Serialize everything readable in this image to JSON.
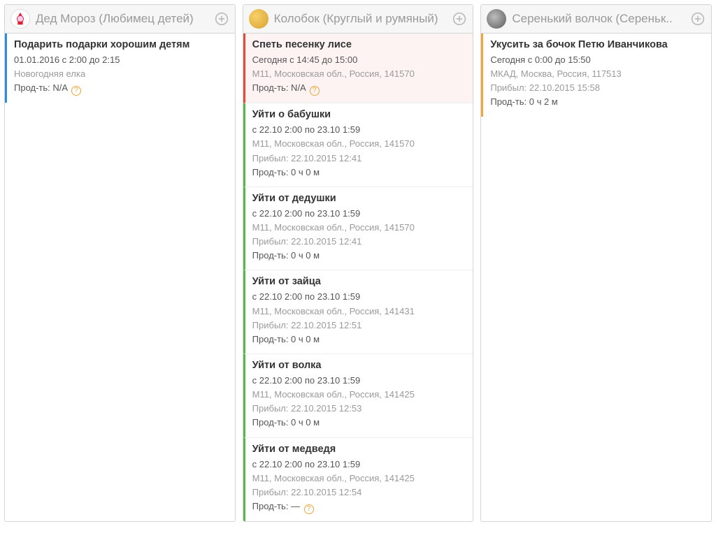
{
  "columns": [
    {
      "id": "ded-moroz",
      "avatar": "ded",
      "title": "Дед Мороз (Любимец детей)",
      "tasks": [
        {
          "color": "blue",
          "title": "Подарить подарки хорошим детям",
          "time": "01.01.2016 с 2:00 до 2:15",
          "location": "Новогодняя елка",
          "arrived": "",
          "duration": "Прод-ть: N/A",
          "help": true
        }
      ]
    },
    {
      "id": "kolobok",
      "avatar": "kolobok",
      "title": "Колобок (Круглый и румяный)",
      "tasks": [
        {
          "color": "red",
          "title": "Спеть песенку лисе",
          "time": "Сегодня с 14:45 до 15:00",
          "location": "М11, Московская обл., Россия, 141570",
          "arrived": "",
          "duration": "Прод-ть: N/A",
          "help": true
        },
        {
          "color": "green",
          "title": "Уйти о бабушки",
          "time": "с 22.10 2:00 по 23.10 1:59",
          "location": "М11, Московская обл., Россия, 141570",
          "arrived": "Прибыл: 22.10.2015 12:41",
          "duration": "Прод-ть: 0 ч 0 м",
          "help": false
        },
        {
          "color": "green",
          "title": "Уйти от дедушки",
          "time": "с 22.10 2:00 по 23.10 1:59",
          "location": "М11, Московская обл., Россия, 141570",
          "arrived": "Прибыл: 22.10.2015 12:41",
          "duration": "Прод-ть: 0 ч 0 м",
          "help": false
        },
        {
          "color": "green",
          "title": "Уйти от зайца",
          "time": "с 22.10 2:00 по 23.10 1:59",
          "location": "М11, Московская обл., Россия, 141431",
          "arrived": "Прибыл: 22.10.2015 12:51",
          "duration": "Прод-ть: 0 ч 0 м",
          "help": false
        },
        {
          "color": "green",
          "title": "Уйти от волка",
          "time": "с 22.10 2:00 по 23.10 1:59",
          "location": "М11, Московская обл., Россия, 141425",
          "arrived": "Прибыл: 22.10.2015 12:53",
          "duration": "Прод-ть: 0 ч 0 м",
          "help": false
        },
        {
          "color": "green",
          "title": "Уйти от медведя",
          "time": "с 22.10 2:00 по 23.10 1:59",
          "location": "М11, Московская обл., Россия, 141425",
          "arrived": "Прибыл: 22.10.2015 12:54",
          "duration": "Прод-ть: —",
          "help": true
        }
      ]
    },
    {
      "id": "wolf",
      "avatar": "wolf",
      "title": "Серенький волчок (Сереньк..",
      "tasks": [
        {
          "color": "orange",
          "title": "Укусить за бочок Петю Иванчикова",
          "time": "Сегодня с 0:00 до 15:50",
          "location": "МКАД, Москва, Россия, 117513",
          "arrived": "Прибыл: 22.10.2015 15:58",
          "duration": "Прод-ть: 0 ч 2 м",
          "help": false
        }
      ]
    }
  ]
}
